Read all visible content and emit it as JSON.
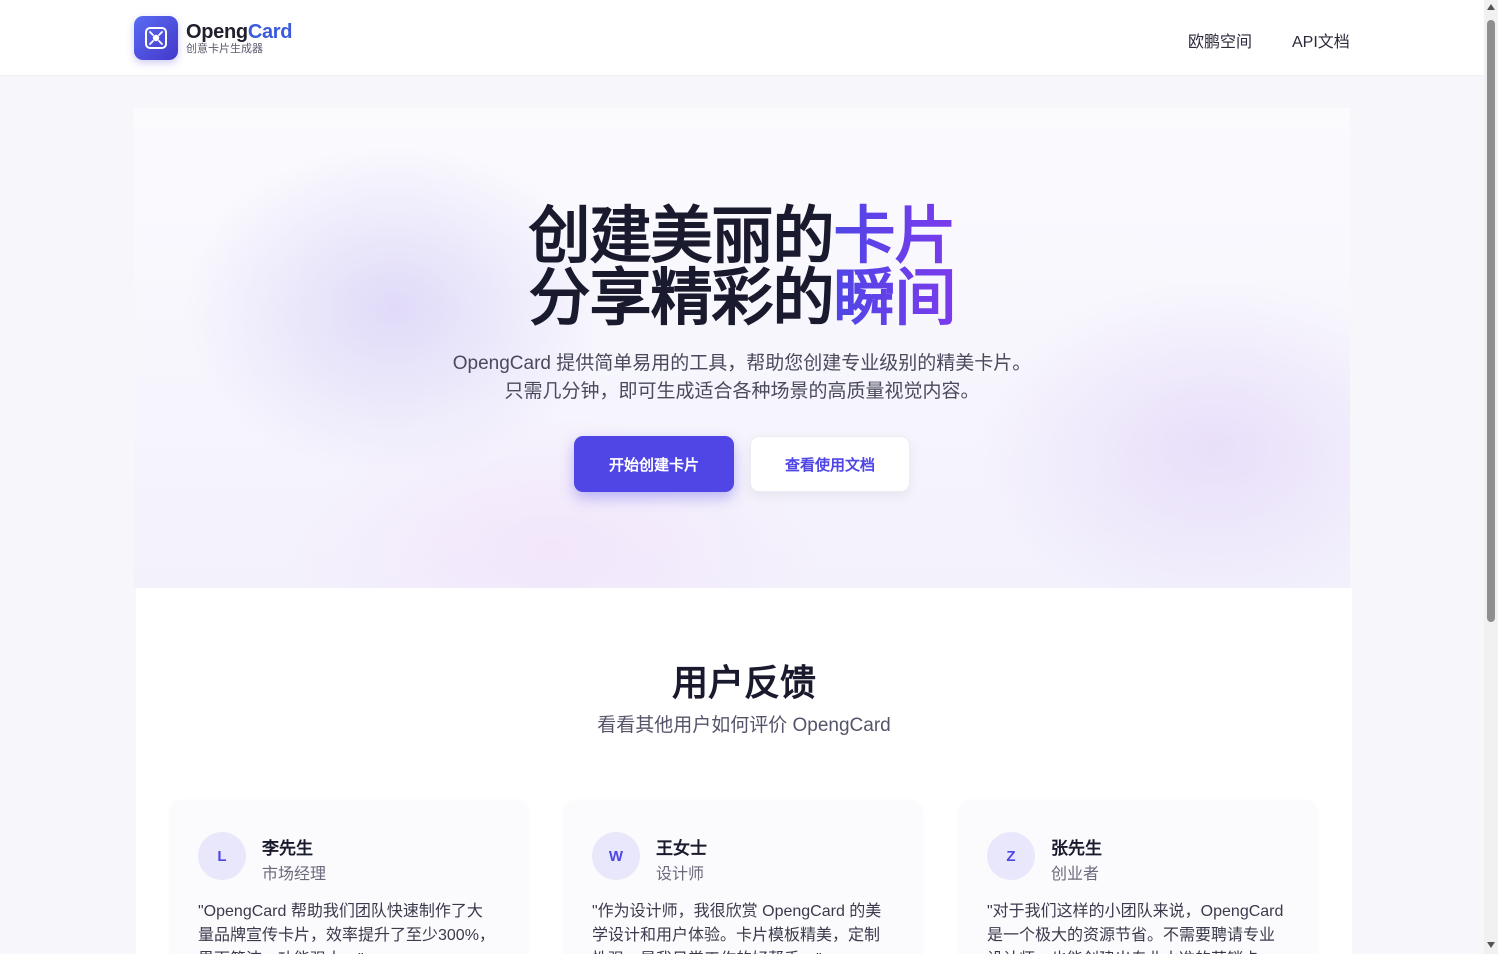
{
  "header": {
    "logo_name_main": "Openg",
    "logo_name_accent": "Card",
    "logo_subtitle": "创意卡片生成器",
    "logo_icon": "card-spark-icon",
    "nav": [
      {
        "label": "欧鹏空间"
      },
      {
        "label": "API文档"
      }
    ]
  },
  "hero": {
    "title_line1_plain": "创建美丽的",
    "title_line1_accent": "卡片",
    "title_line2_plain": "分享精彩的",
    "title_line2_accent": "瞬间",
    "desc_line1": "OpengCard 提供简单易用的工具，帮助您创建专业级别的精美卡片。",
    "desc_line2": "只需几分钟，即可生成适合各种场景的高质量视觉内容。",
    "primary_button": "开始创建卡片",
    "secondary_button": "查看使用文档"
  },
  "feedback": {
    "title": "用户反馈",
    "subtitle": "看看其他用户如何评价 OpengCard",
    "testimonials": [
      {
        "initial": "L",
        "name": "李先生",
        "role": "市场经理",
        "quote": "\"OpengCard 帮助我们团队快速制作了大量品牌宣传卡片，效率提升了至少300%，界面简洁，功能强大。\""
      },
      {
        "initial": "W",
        "name": "王女士",
        "role": "设计师",
        "quote": "\"作为设计师，我很欣赏 OpengCard 的美学设计和用户体验。卡片模板精美，定制性强，是我日常工作的好帮手。\""
      },
      {
        "initial": "Z",
        "name": "张先生",
        "role": "创业者",
        "quote": "\"对于我们这样的小团队来说，OpengCard 是一个极大的资源节省。不需要聘请专业设计师，也能创建出专业水准的营销卡片。\""
      }
    ]
  },
  "colors": {
    "accent": "#4f46e5",
    "logo_accent": "#3b5bdb"
  }
}
